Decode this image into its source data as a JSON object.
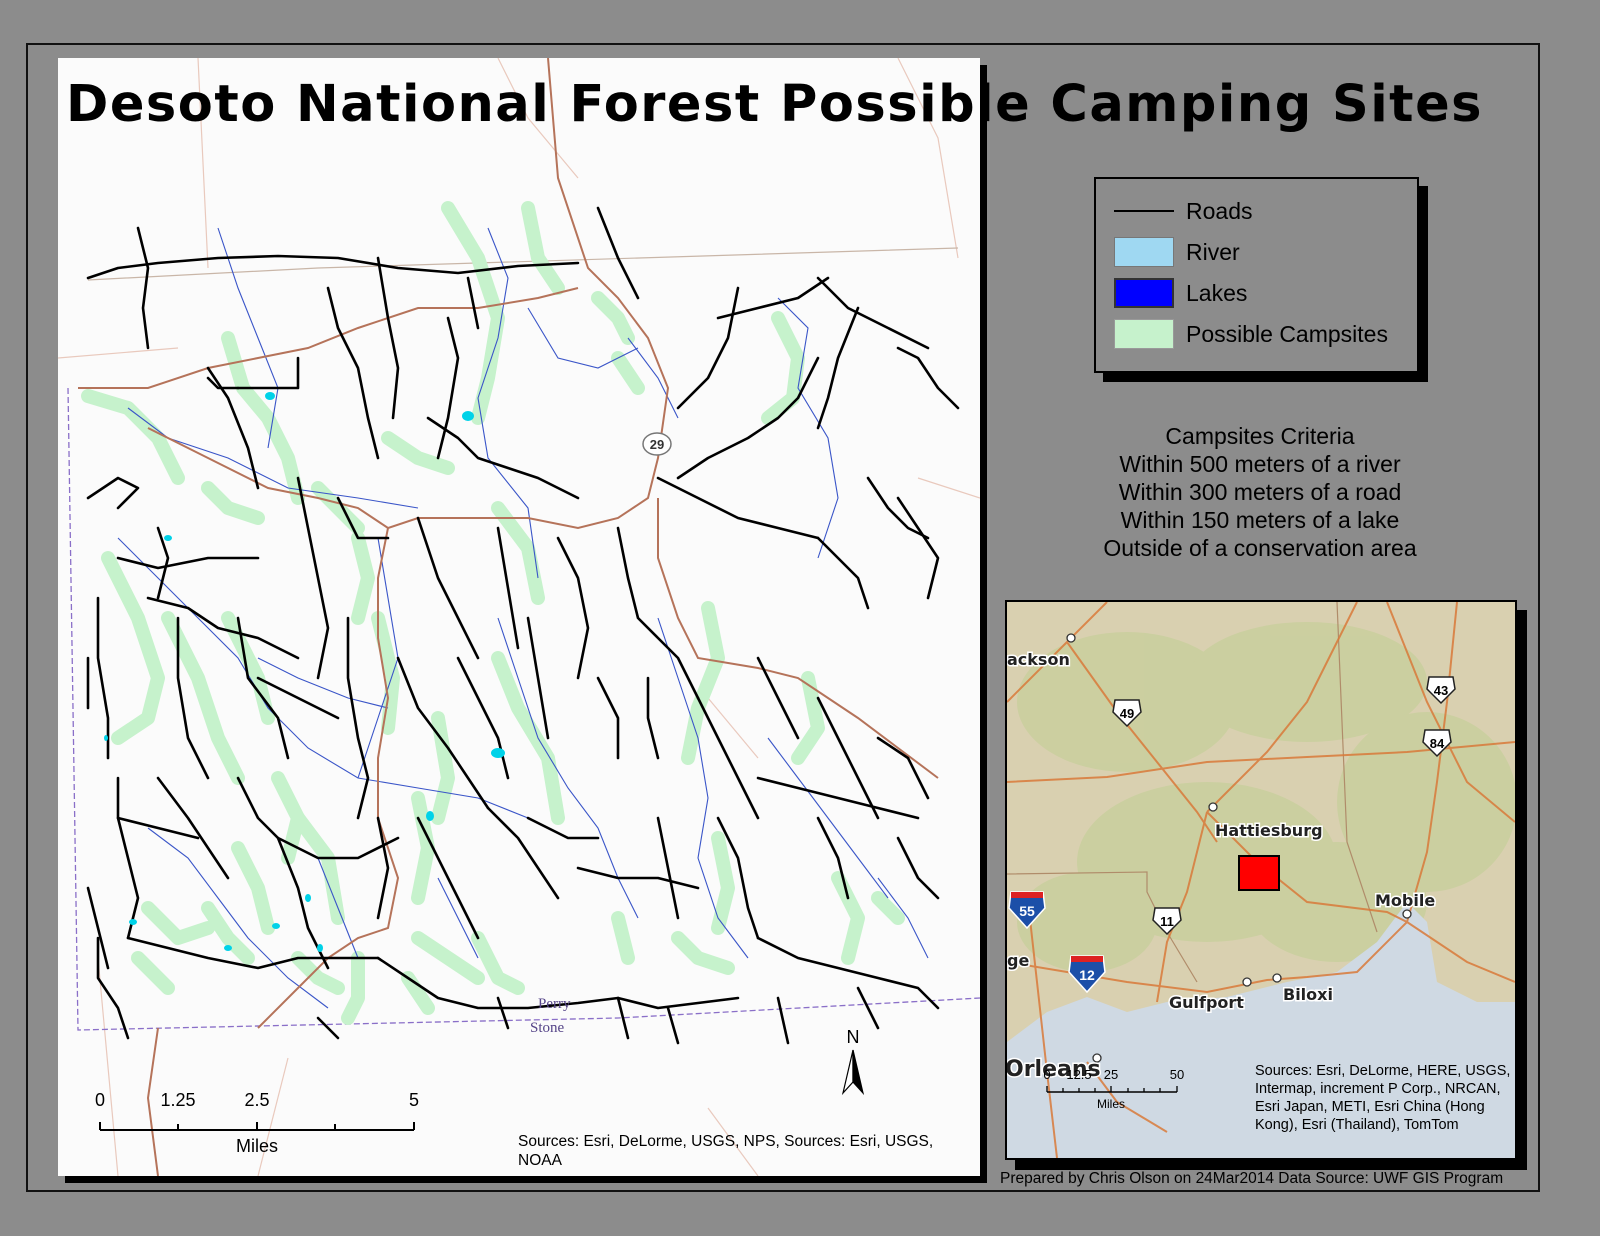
{
  "title": "Desoto National Forest Possible Camping Sites",
  "legend": {
    "items": [
      {
        "label": "Roads",
        "symbol": "line",
        "color": "#000000"
      },
      {
        "label": "River",
        "symbol": "fill",
        "color": "#9fd8f2"
      },
      {
        "label": "Lakes",
        "symbol": "fill",
        "color": "#0000ff"
      },
      {
        "label": "Possible Campsites",
        "symbol": "fill",
        "color": "#c6f2cc"
      }
    ]
  },
  "criteria": {
    "heading": "Campsites Criteria",
    "lines": [
      "Within 500 meters of a river",
      "Within 300 meters of a road",
      "Within 150 meters of a lake",
      "Outside of a conservation area"
    ]
  },
  "main_map": {
    "highway_shield": "29",
    "place_labels": [
      "Perry",
      "Stone"
    ],
    "north_label": "N",
    "scale_labels": [
      "0",
      "1.25",
      "2.5",
      "5"
    ],
    "scale_unit": "Miles",
    "sources": "Sources: Esri, DeLorme, USGS, NPS, Sources: Esri, USGS, NOAA",
    "colors": {
      "road": "#000000",
      "river": "#3a55c8",
      "campsite": "#c6f2cc",
      "lake": "#00d2e8",
      "highway": "#b5735a",
      "county_line": "#8a6fc8"
    }
  },
  "inset_map": {
    "cities": [
      "ackson",
      "Hattiesburg",
      "Mobile",
      "Gulfport",
      "Biloxi",
      "Orleans",
      "ge"
    ],
    "route_shields": [
      "49",
      "43",
      "84",
      "11",
      "55",
      "12"
    ],
    "scale_labels": [
      "0",
      "12.5",
      "25",
      "50"
    ],
    "scale_unit": "Miles",
    "sources": "Sources: Esri, DeLorme, HERE, USGS, Intermap, increment P Corp., NRCAN, Esri Japan, METI, Esri China (Hong Kong), Esri (Thailand), TomTom",
    "study_area_color": "#ff0000"
  },
  "footer": "Prepared by Chris Olson on 24Mar2014 Data Source: UWF GIS Program"
}
